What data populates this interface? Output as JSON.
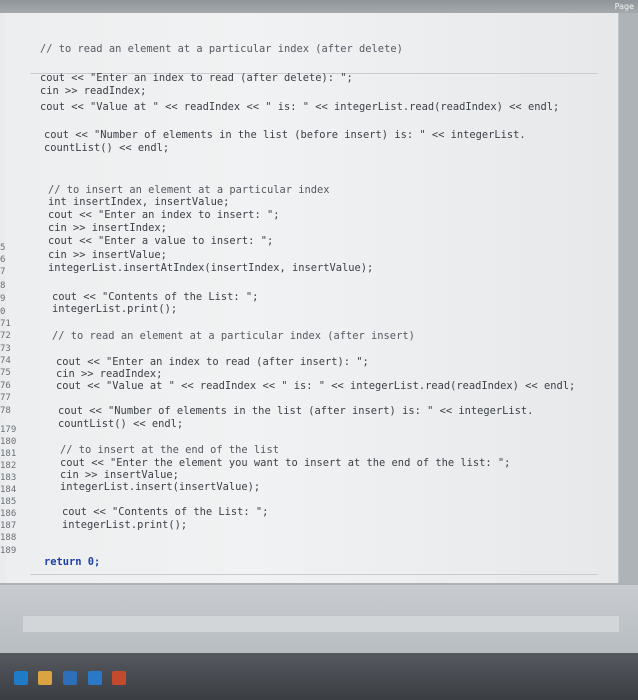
{
  "window": {
    "page_label": "Page"
  },
  "code": {
    "lines": [
      {
        "num": "",
        "text": "// to read an element at a particular index (after delete)",
        "kind": "comment"
      },
      {
        "num": "",
        "text": "cout << \"Enter an index to read (after delete): \";",
        "kind": "code"
      },
      {
        "num": "",
        "text": "cin >> readIndex;",
        "kind": "code"
      },
      {
        "num": "",
        "text": "cout << \"Value at \" << readIndex << \" is: \" << integerList.read(readIndex) << endl;",
        "kind": "code"
      },
      {
        "num": "",
        "text": "cout << \"Number of elements in the list (before insert) is: \" << integerList.",
        "kind": "code"
      },
      {
        "num": "",
        "text": "countList() << endl;",
        "kind": "code"
      },
      {
        "num": "",
        "text": "// to insert an element at a particular index",
        "kind": "comment"
      },
      {
        "num": "",
        "text": "int insertIndex, insertValue;",
        "kind": "code"
      },
      {
        "num": "",
        "text": "cout << \"Enter an index to insert: \";",
        "kind": "code"
      },
      {
        "num": "",
        "text": "cin >> insertIndex;",
        "kind": "code"
      },
      {
        "num": "5",
        "text": "cout << \"Enter a value to insert: \";",
        "kind": "code"
      },
      {
        "num": "6",
        "text": "cin >> insertValue;",
        "kind": "code"
      },
      {
        "num": "7",
        "text": "integerList.insertAtIndex(insertIndex, insertValue);",
        "kind": "code"
      },
      {
        "num": "8",
        "text": "",
        "kind": "code"
      },
      {
        "num": "9",
        "text": "cout << \"Contents of the List: \";",
        "kind": "code"
      },
      {
        "num": "0",
        "text": "integerList.print();",
        "kind": "code"
      },
      {
        "num": "71",
        "text": "",
        "kind": "code"
      },
      {
        "num": "72",
        "text": "// to read an element at a particular index (after insert)",
        "kind": "comment"
      },
      {
        "num": "73",
        "text": "",
        "kind": "code"
      },
      {
        "num": "74",
        "text": "cout << \"Enter an index to read (after insert): \";",
        "kind": "code"
      },
      {
        "num": "75",
        "text": "cin >> readIndex;",
        "kind": "code"
      },
      {
        "num": "76",
        "text": "cout << \"Value at \" << readIndex << \" is: \" << integerList.read(readIndex) << endl;",
        "kind": "code"
      },
      {
        "num": "77",
        "text": "",
        "kind": "code"
      },
      {
        "num": "78",
        "text": "cout << \"Number of elements in the list (after insert) is: \" << integerList.",
        "kind": "code"
      },
      {
        "num": "",
        "text": "countList() << endl;",
        "kind": "code"
      },
      {
        "num": "179",
        "text": "",
        "kind": "code"
      },
      {
        "num": "180",
        "text": "// to insert at the end of the list",
        "kind": "comment"
      },
      {
        "num": "181",
        "text": "cout << \"Enter the element you want to insert at the end of the list: \";",
        "kind": "code"
      },
      {
        "num": "182",
        "text": "cin >> insertValue;",
        "kind": "code"
      },
      {
        "num": "183",
        "text": "integerList.insert(insertValue);",
        "kind": "code"
      },
      {
        "num": "184",
        "text": "",
        "kind": "code"
      },
      {
        "num": "185",
        "text": "cout << \"Contents of the List: \";",
        "kind": "code"
      },
      {
        "num": "186",
        "text": "integerList.print();",
        "kind": "code"
      },
      {
        "num": "187",
        "text": "",
        "kind": "code"
      },
      {
        "num": "188",
        "text": "",
        "kind": "code"
      },
      {
        "num": "189",
        "text": "return 0;",
        "kind": "keyword"
      }
    ]
  },
  "colors": {
    "code_text": "#3b3f46",
    "comment_text": "#555a62",
    "keyword": "#1c3faa",
    "page_bg": "#e9ebec",
    "taskbar": "#3a3d42"
  },
  "taskbar": {
    "icons": [
      "edge-browser-icon",
      "file-explorer-icon",
      "store-icon",
      "mail-icon",
      "app-icon"
    ]
  }
}
